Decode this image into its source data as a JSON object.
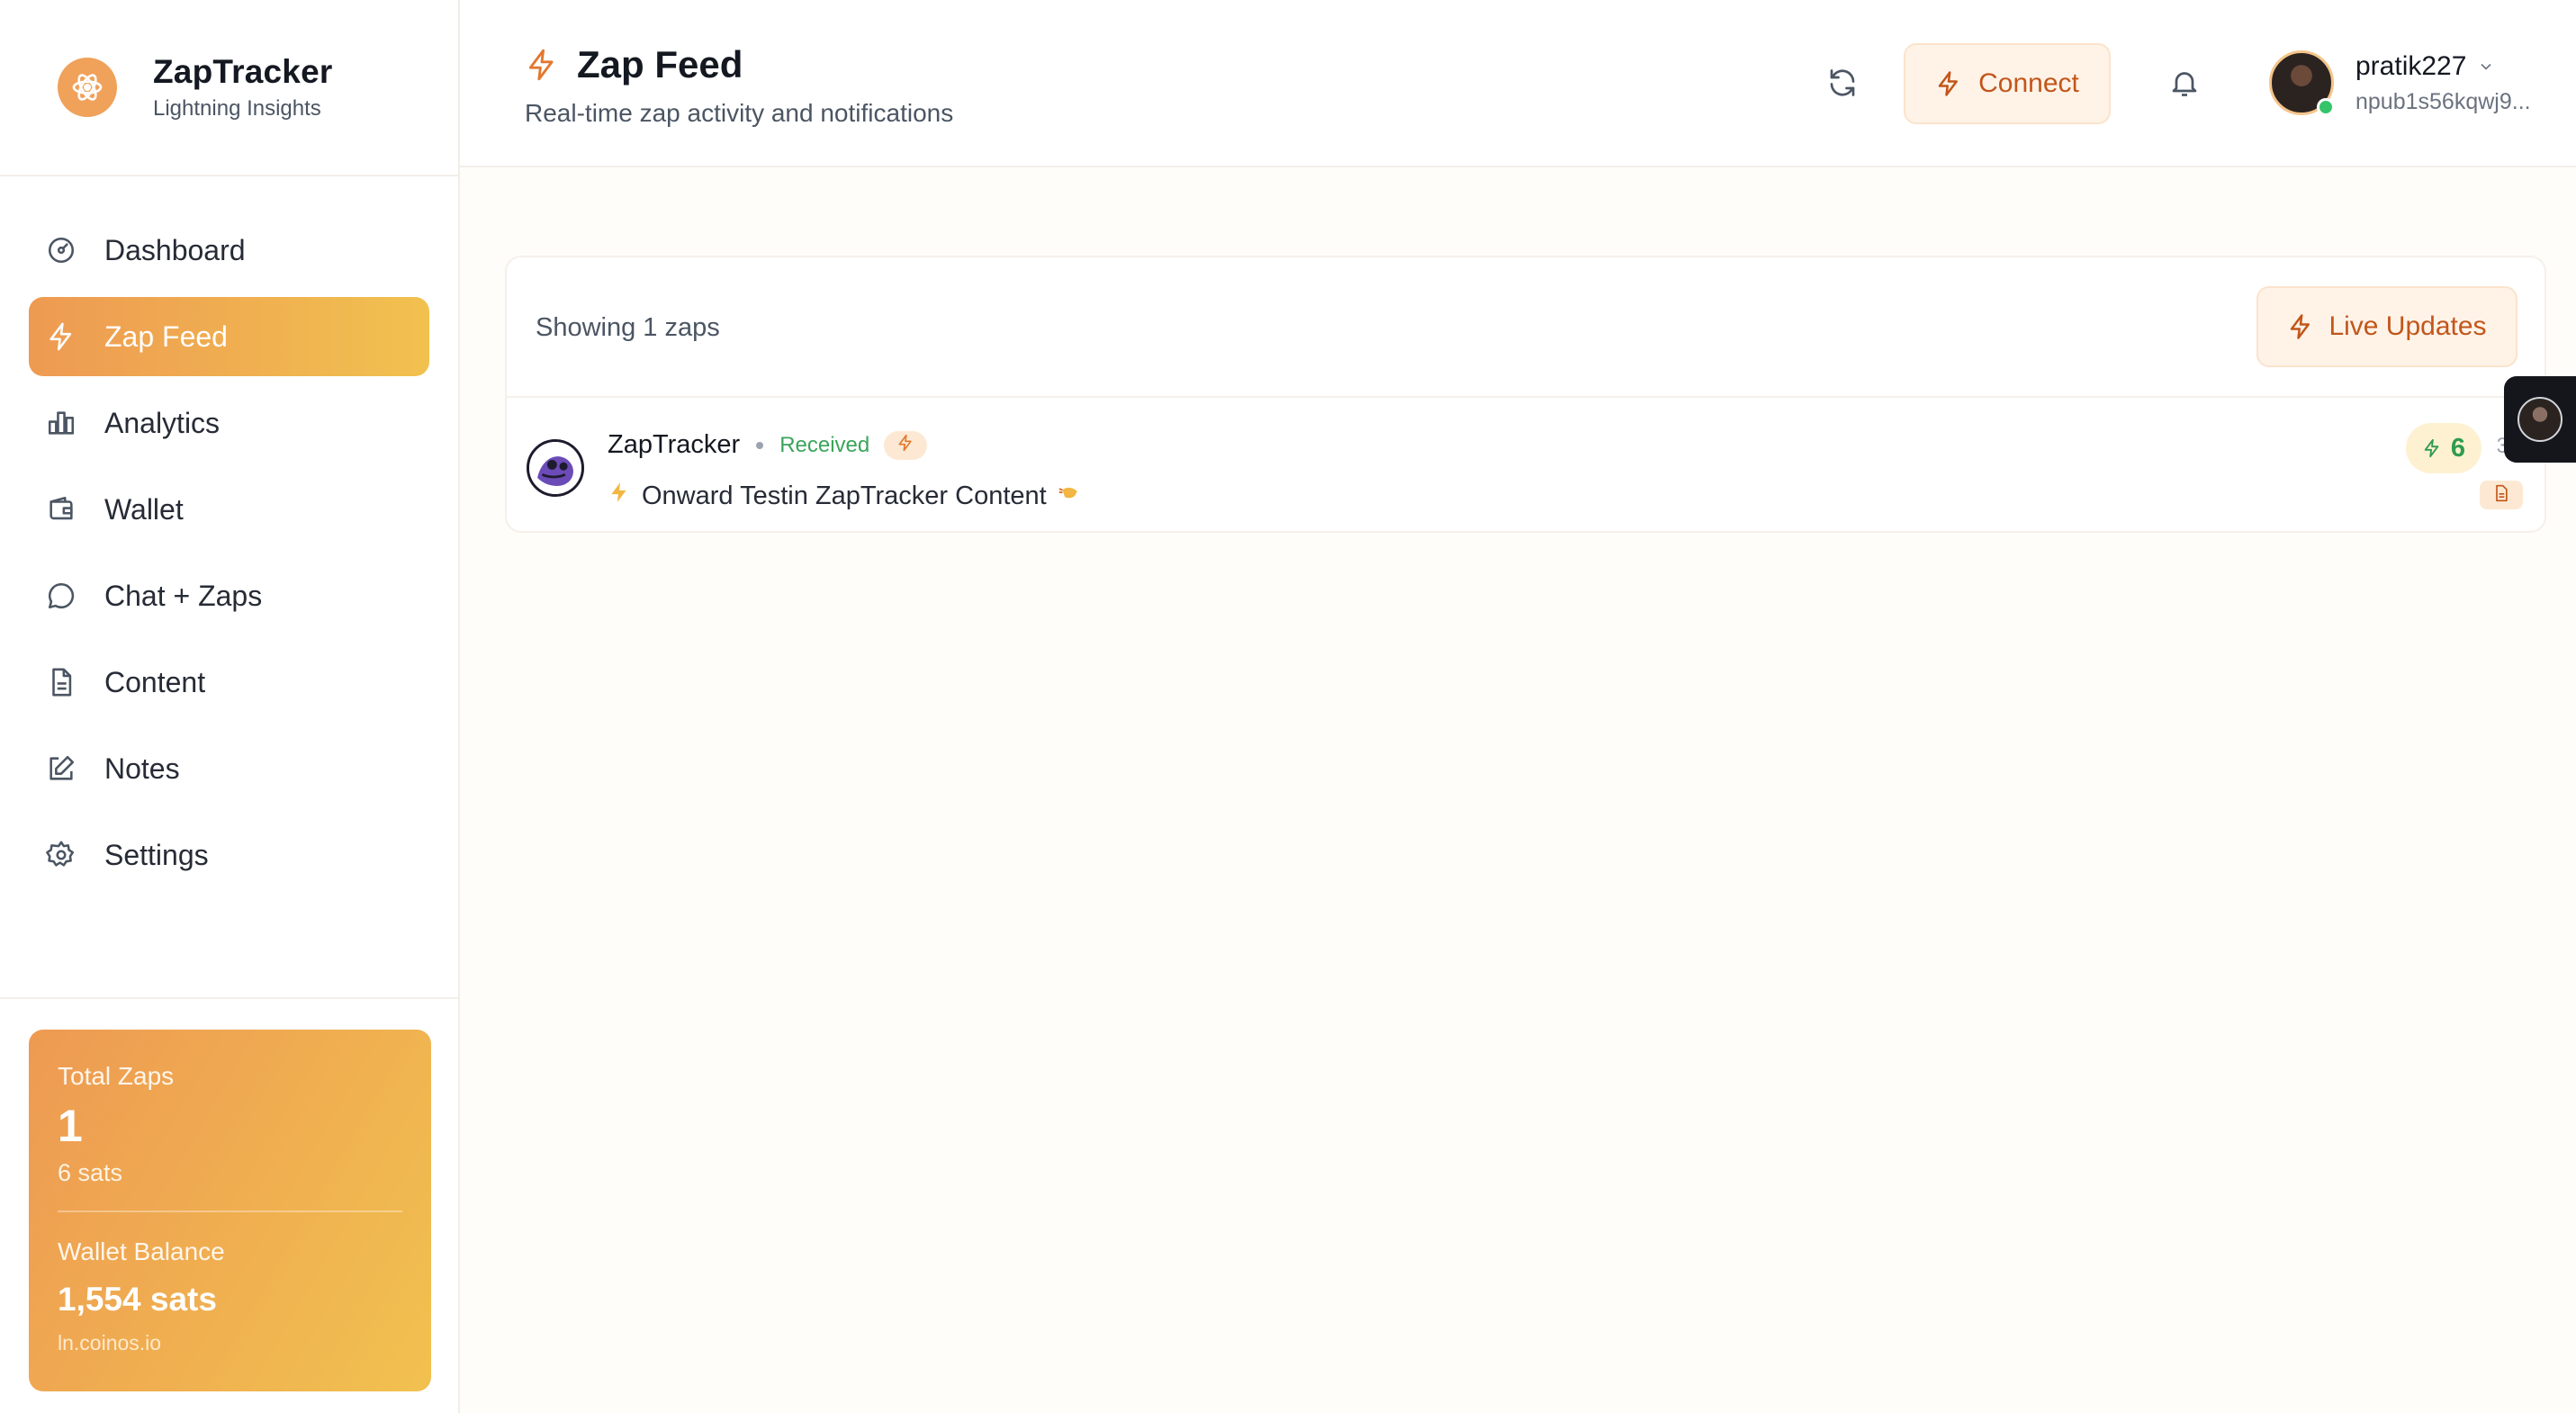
{
  "brand": {
    "title": "ZapTracker",
    "subtitle": "Lightning Insights",
    "logo_icon": "atom-icon"
  },
  "sidebar": {
    "items": [
      {
        "label": "Dashboard",
        "icon": "gauge-icon",
        "active": false
      },
      {
        "label": "Zap Feed",
        "icon": "bolt-icon",
        "active": true
      },
      {
        "label": "Analytics",
        "icon": "bar-chart-icon",
        "active": false
      },
      {
        "label": "Wallet",
        "icon": "wallet-icon",
        "active": false
      },
      {
        "label": "Chat + Zaps",
        "icon": "chat-icon",
        "active": false
      },
      {
        "label": "Content",
        "icon": "document-icon",
        "active": false
      },
      {
        "label": "Notes",
        "icon": "edit-icon",
        "active": false
      },
      {
        "label": "Settings",
        "icon": "gear-icon",
        "active": false
      }
    ]
  },
  "stats": {
    "total_zaps_label": "Total Zaps",
    "total_zaps_value": "1",
    "total_zaps_sats": "6 sats",
    "wallet_balance_label": "Wallet Balance",
    "wallet_balance_value": "1,554 sats",
    "wallet_host": "ln.coinos.io"
  },
  "header": {
    "title": "Zap Feed",
    "subtitle": "Real-time zap activity and notifications",
    "connect_label": "Connect"
  },
  "user": {
    "name": "pratik227",
    "npub": "npub1s56kqwj9..."
  },
  "feed": {
    "showing_text": "Showing 1 zaps",
    "live_updates_label": "Live Updates",
    "zaps": [
      {
        "name": "ZapTracker",
        "status": "Received",
        "content": "Onward Testin ZapTracker Content",
        "amount": "6",
        "trailing": "3"
      }
    ]
  },
  "colors": {
    "accent": "#ee9a52",
    "accent2": "#f1c14f",
    "success": "#3aa55a",
    "accent_text": "#c2561a"
  }
}
